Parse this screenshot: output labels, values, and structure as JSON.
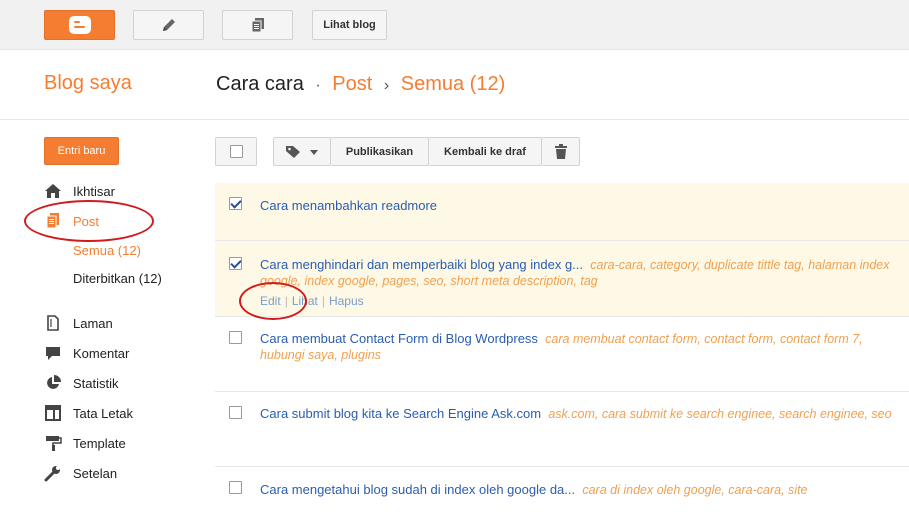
{
  "toolbar": {
    "view_blog_label": "Lihat blog"
  },
  "header": {
    "my_blogs": "Blog saya",
    "blog_name": "Cara cara",
    "dot": "·",
    "section": "Post",
    "arrow": "›",
    "filter": "Semua (12)"
  },
  "sidebar": {
    "new_entry": "Entri baru",
    "items": [
      {
        "label": "Ikhtisar",
        "icon": "home-icon"
      },
      {
        "label": "Post",
        "icon": "posts-icon"
      },
      {
        "label": "Laman",
        "icon": "pages-icon"
      },
      {
        "label": "Komentar",
        "icon": "comment-icon"
      },
      {
        "label": "Statistik",
        "icon": "pie-chart-icon"
      },
      {
        "label": "Tata Letak",
        "icon": "layout-icon"
      },
      {
        "label": "Template",
        "icon": "paint-roller-icon"
      },
      {
        "label": "Setelan",
        "icon": "wrench-icon"
      }
    ],
    "sub_items": [
      {
        "label": "Semua (12)"
      },
      {
        "label": "Diterbitkan (12)"
      }
    ]
  },
  "actions": {
    "publish": "Publikasikan",
    "revert": "Kembali ke draf"
  },
  "posts": [
    {
      "title": "Cara menambahkan readmore",
      "labels": "",
      "checked": true
    },
    {
      "title": "Cara menghindari dan memperbaiki blog yang index g...",
      "labels": "cara-cara, category, duplicate tittle tag, halaman index google, index google, pages, seo, short meta description, tag",
      "checked": true,
      "row_actions": [
        "Edit",
        "Lihat",
        "Hapus"
      ]
    },
    {
      "title": "Cara membuat Contact Form di Blog Wordpress",
      "labels": "cara membuat contact form, contact form, contact form 7, hubungi saya, plugins",
      "checked": false
    },
    {
      "title": "Cara submit blog kita ke Search Engine Ask.com",
      "labels": "ask.com, cara submit ke search enginee, search enginee, seo",
      "checked": false
    },
    {
      "title": "Cara mengetahui blog sudah di index oleh google da...",
      "labels": "cara di index oleh google, cara-cara, site",
      "checked": false
    }
  ],
  "colors": {
    "accent": "#f57d31",
    "link": "#2a5db0",
    "label": "#f0a050",
    "selected_row": "#fef9e7",
    "annotation": "#d01c1c"
  }
}
